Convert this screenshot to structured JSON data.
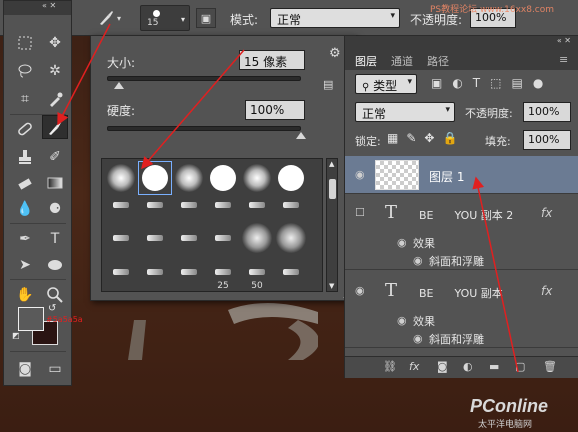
{
  "watermark_top": "PS教程论坛 www.16xx8.com",
  "options_bar": {
    "brush_size": "15",
    "mode_label": "模式:",
    "mode_value": "正常",
    "opacity_label": "不透明度:",
    "opacity_value": "100%"
  },
  "brush_popup": {
    "size_label": "大小:",
    "size_value": "15 像素",
    "hardness_label": "硬度:",
    "hardness_value": "100%",
    "size_fraction": 0.06,
    "hardness_fraction": 1.0,
    "brush_numbers": [
      "25",
      "50"
    ]
  },
  "toolbar": {
    "color_annotation": "#5a5a5a"
  },
  "layers": {
    "tabs": [
      "图层",
      "通道",
      "路径"
    ],
    "filter_label": "类型",
    "blend_mode": "正常",
    "opacity_label": "不透明度:",
    "opacity_value": "100%",
    "lock_label": "锁定:",
    "fill_label": "填充:",
    "fill_value": "100%",
    "items": [
      {
        "name": "图层 1"
      },
      {
        "name": "BE      YOU 副本 2",
        "effects_label": "效果",
        "effect": "斜面和浮雕"
      },
      {
        "name": "BE      YOU 副本",
        "effects_label": "效果",
        "effect": "斜面和浮雕"
      }
    ]
  },
  "site_logo": {
    "brand": "PConline",
    "subtitle": "太平洋电脑网"
  },
  "colors": {
    "annotation": "#e02020",
    "panel_bg": "#535353",
    "selected_layer": "#6b7b93",
    "background_brown": "#4a2818"
  }
}
